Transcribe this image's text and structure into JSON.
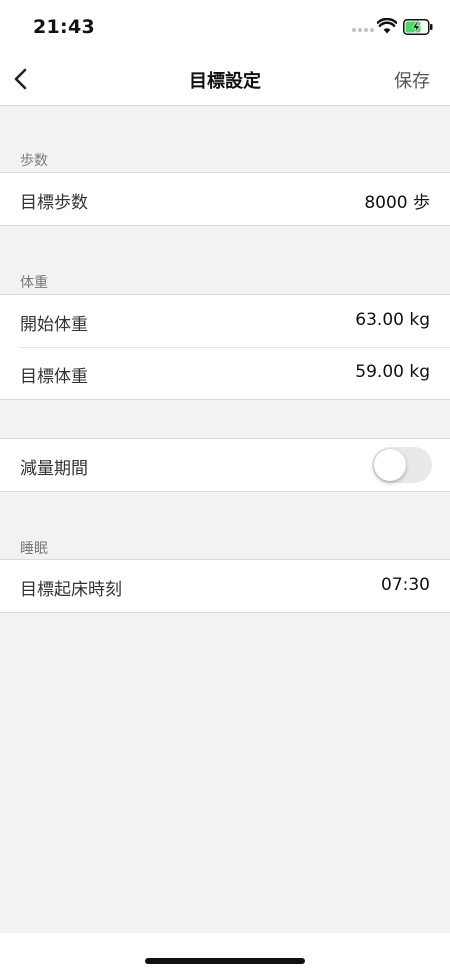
{
  "status_bar": {
    "time": "21:43",
    "icons": [
      "signal-dots-icon",
      "wifi-icon",
      "battery-charging-icon"
    ],
    "battery_color": "#4cd964"
  },
  "nav": {
    "back_icon": "chevron-left-icon",
    "title": "目標設定",
    "save_label": "保存"
  },
  "sections": {
    "steps": {
      "header": "歩数",
      "rows": [
        {
          "label": "目標歩数",
          "value": "8000 歩"
        }
      ]
    },
    "weight": {
      "header": "体重",
      "rows": [
        {
          "label": "開始体重",
          "value": "63.00 kg"
        },
        {
          "label": "目標体重",
          "value": "59.00 kg"
        }
      ]
    },
    "reduction": {
      "rows": [
        {
          "label": "減量期間",
          "toggle_on": false
        }
      ]
    },
    "sleep": {
      "header": "睡眠",
      "rows": [
        {
          "label": "目標起床時刻",
          "value": "07:30"
        }
      ]
    }
  }
}
